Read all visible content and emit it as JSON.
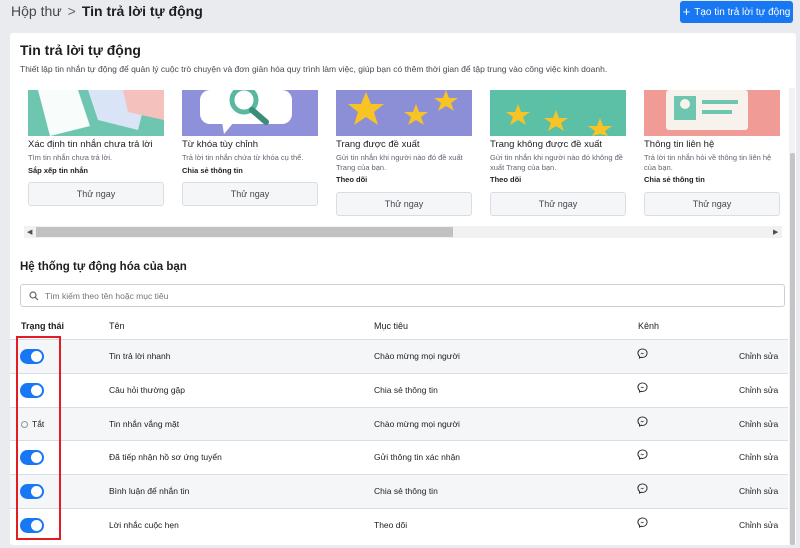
{
  "breadcrumb": {
    "root": "Hộp thư",
    "separator": ">",
    "current": "Tin trả lời tự động"
  },
  "create_button": {
    "icon": "plus-icon",
    "label": "Tạo tin trả lời tự động"
  },
  "section": {
    "title": "Tin trả lời tự động",
    "description": "Thiết lập tin nhắn tự động để quản lý cuộc trò chuyện và đơn giản hóa quy trình làm việc, giúp bạn có thêm thời gian để tập trung vào công việc kinh doanh."
  },
  "templates": [
    {
      "title": "Xác định tin nhắn chưa trả lời",
      "description": "Tìm tin nhắn chưa trả lời.",
      "tag": "Sắp xếp tin nhắn",
      "button": "Thử ngay",
      "image_color": "#6fc6b0"
    },
    {
      "title": "Từ khóa tùy chỉnh",
      "description": "Trả lời tin nhắn chứa từ khóa cụ thể.",
      "tag": "Chia sẻ thông tin",
      "button": "Thử ngay",
      "image_color": "#8e90d9"
    },
    {
      "title": "Trang được đề xuất",
      "description": "Gửi tin nhắn khi người nào đó đề xuất Trang của bạn.",
      "tag": "Theo dõi",
      "button": "Thử ngay",
      "image_color": "#8c8fd6"
    },
    {
      "title": "Trang không được đề xuất",
      "description": "Gửi tin nhắn khi người nào đó không đề xuất Trang của bạn.",
      "tag": "Theo dõi",
      "button": "Thử ngay",
      "image_color": "#5cc0a7"
    },
    {
      "title": "Thông tin liên hệ",
      "description": "Trả lời tin nhắn hỏi về thông tin liên hệ của bạn.",
      "tag": "Chia sẻ thông tin",
      "button": "Thử ngay",
      "image_color": "#f19b96"
    }
  ],
  "automations": {
    "title": "Hệ thống tự động hóa của bạn",
    "search_placeholder": "Tìm kiếm theo tên hoặc mục tiêu",
    "columns": {
      "status": "Trạng thái",
      "name": "Tên",
      "goal": "Mục tiêu",
      "channel": "Kênh"
    },
    "rows": [
      {
        "enabled": true,
        "status_label": "",
        "name": "Tin trả lời nhanh",
        "goal": "Chào mừng mọi người",
        "channel_icon": "messenger-icon",
        "action": "Chỉnh sửa"
      },
      {
        "enabled": true,
        "status_label": "",
        "name": "Câu hỏi thường gặp",
        "goal": "Chia sẻ thông tin",
        "channel_icon": "messenger-icon",
        "action": "Chỉnh sửa"
      },
      {
        "enabled": false,
        "status_label": "Tắt",
        "name": "Tin nhắn vắng mặt",
        "goal": "Chào mừng mọi người",
        "channel_icon": "messenger-icon",
        "action": "Chỉnh sửa"
      },
      {
        "enabled": true,
        "status_label": "",
        "name": "Đã tiếp nhận hồ sơ ứng tuyển",
        "goal": "Gửi thông tin xác nhận",
        "channel_icon": "messenger-icon",
        "action": "Chỉnh sửa"
      },
      {
        "enabled": true,
        "status_label": "",
        "name": "Bình luận để nhắn tin",
        "goal": "Chia sẻ thông tin",
        "channel_icon": "messenger-icon",
        "action": "Chỉnh sửa"
      },
      {
        "enabled": true,
        "status_label": "",
        "name": "Lời nhắc cuộc hẹn",
        "goal": "Theo dõi",
        "channel_icon": "messenger-icon",
        "action": "Chỉnh sửa"
      }
    ]
  },
  "colors": {
    "accent": "#1877f2",
    "highlight_box": "#e31b23"
  }
}
